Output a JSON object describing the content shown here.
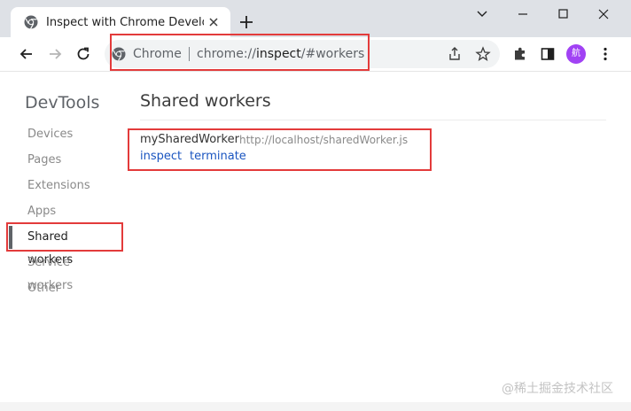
{
  "tab": {
    "title": "Inspect with Chrome Developer Tools"
  },
  "omnibox": {
    "site_chip": "Chrome",
    "url_scheme": "chrome://",
    "url_host": "inspect",
    "url_path": "/#workers"
  },
  "profile": {
    "avatar_text": "航"
  },
  "sidebar": {
    "title": "DevTools",
    "items": [
      {
        "label": "Devices"
      },
      {
        "label": "Pages"
      },
      {
        "label": "Extensions"
      },
      {
        "label": "Apps"
      },
      {
        "label": "Shared workers"
      },
      {
        "label": "Service workers"
      },
      {
        "label": "Other"
      }
    ]
  },
  "main": {
    "section_title": "Shared workers",
    "workers": [
      {
        "name": "mySharedWorker",
        "url": "http://localhost/sharedWorker.js",
        "actions": [
          "inspect",
          "terminate"
        ]
      }
    ]
  },
  "watermark": "@稀土掘金技术社区",
  "colors": {
    "highlight": "#e33b3b",
    "link": "#1a55c0",
    "avatar": "#a142f4",
    "tabstrip": "#dee1e6"
  },
  "icons": [
    "chrome-favicon-icon",
    "close-icon",
    "plus-icon",
    "minimize-icon",
    "maximize-icon",
    "window-close-icon",
    "chevron-down-icon",
    "back-arrow-icon",
    "forward-arrow-icon",
    "reload-icon",
    "share-icon",
    "star-icon",
    "extensions-icon",
    "side-panel-icon",
    "kebab-menu-icon"
  ]
}
